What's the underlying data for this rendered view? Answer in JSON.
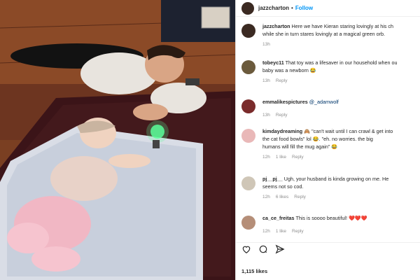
{
  "post": {
    "username": "jazzcharton",
    "follow_label": "Follow",
    "dot": "•"
  },
  "comments": [
    {
      "user": "jazzcharton",
      "line1": "Here we have Kieran staring lovingly at his ch",
      "line2": "while she in turn stares lovingly at a magical green orb.",
      "time": "13h",
      "likes": "",
      "reply": "",
      "avatar_color": "#3b2a22"
    },
    {
      "user": "tobeyc11",
      "line1": "That toy was a lifesaver in our household when ou",
      "line2": "baby was a newborn 😂",
      "time": "13h",
      "likes": "",
      "reply": "Reply",
      "avatar_color": "#6b5a3c"
    },
    {
      "user": "emmalikespictures",
      "line1": "@_adamwolf",
      "line2": "",
      "time": "13h",
      "likes": "",
      "reply": "Reply",
      "avatar_color": "#7a2b2b"
    },
    {
      "user": "kimdaydreaming",
      "line1": "🙈 \"can't wait until I can crawl & get into",
      "line2": "the cat food bowls\" lol 😂. \"eh. no worries. the big",
      "line3": "humans will fill the mug again\" 😂",
      "time": "12h",
      "likes": "1 like",
      "reply": "Reply",
      "avatar_color": "#e9b8b8"
    },
    {
      "user": "pj__pj__",
      "line1": "Ugh, your husband is kinda growing on me. He",
      "line2": "seems not so cod.",
      "time": "12h",
      "likes": "6 likes",
      "reply": "Reply",
      "avatar_color": "#cfc6b7"
    },
    {
      "user": "ca_ce_freitas",
      "line1": "This is soooo beautiful! ❤️❤️❤️",
      "line2": "",
      "time": "12h",
      "likes": "1 like",
      "reply": "Reply",
      "avatar_color": "#b58e78"
    }
  ],
  "likes_count": "1,115 likes",
  "icons": [
    "heart-icon",
    "comment-icon",
    "share-icon"
  ],
  "colors": {
    "follow": "#0095f6",
    "meta": "#8e8e8e",
    "text": "#262626"
  }
}
